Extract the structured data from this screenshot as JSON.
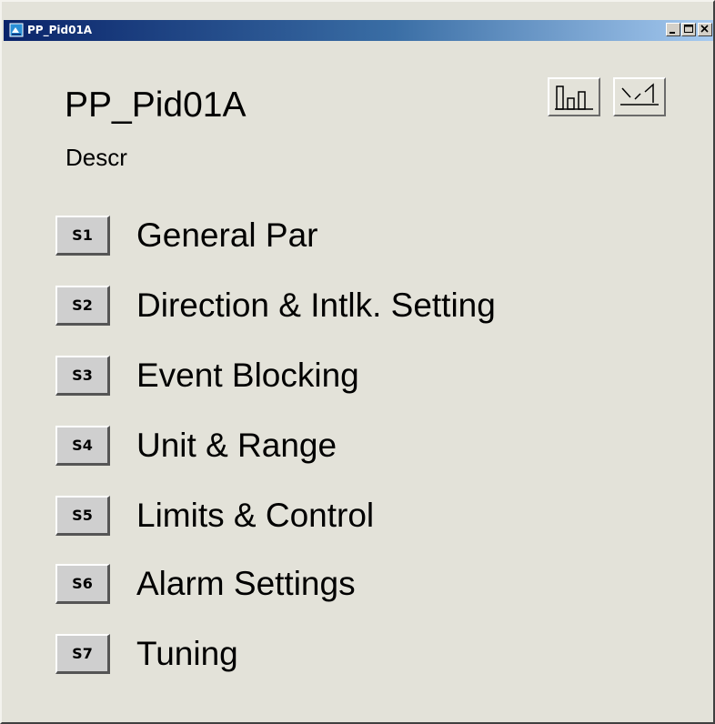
{
  "window": {
    "title": "PP_Pid01A"
  },
  "faceplate": {
    "tag": "PP_Pid01A",
    "description": "Descr",
    "icon_buttons": [
      {
        "name": "bar-chart-icon"
      },
      {
        "name": "trend-icon"
      }
    ]
  },
  "menu": [
    {
      "key": "S1",
      "label": "General Par"
    },
    {
      "key": "S2",
      "label": "Direction & Intlk. Setting"
    },
    {
      "key": "S3",
      "label": "Event Blocking"
    },
    {
      "key": "S4",
      "label": "Unit & Range"
    },
    {
      "key": "S5",
      "label": "Limits & Control"
    },
    {
      "key": "S6",
      "label": "Alarm Settings"
    },
    {
      "key": "S7",
      "label": "Tuning"
    }
  ],
  "colors": {
    "panel": "#e3e2d9",
    "title_bar_start": "#0a246a",
    "title_bar_end": "#a6caf0",
    "button_face": "#cfcfcf"
  }
}
